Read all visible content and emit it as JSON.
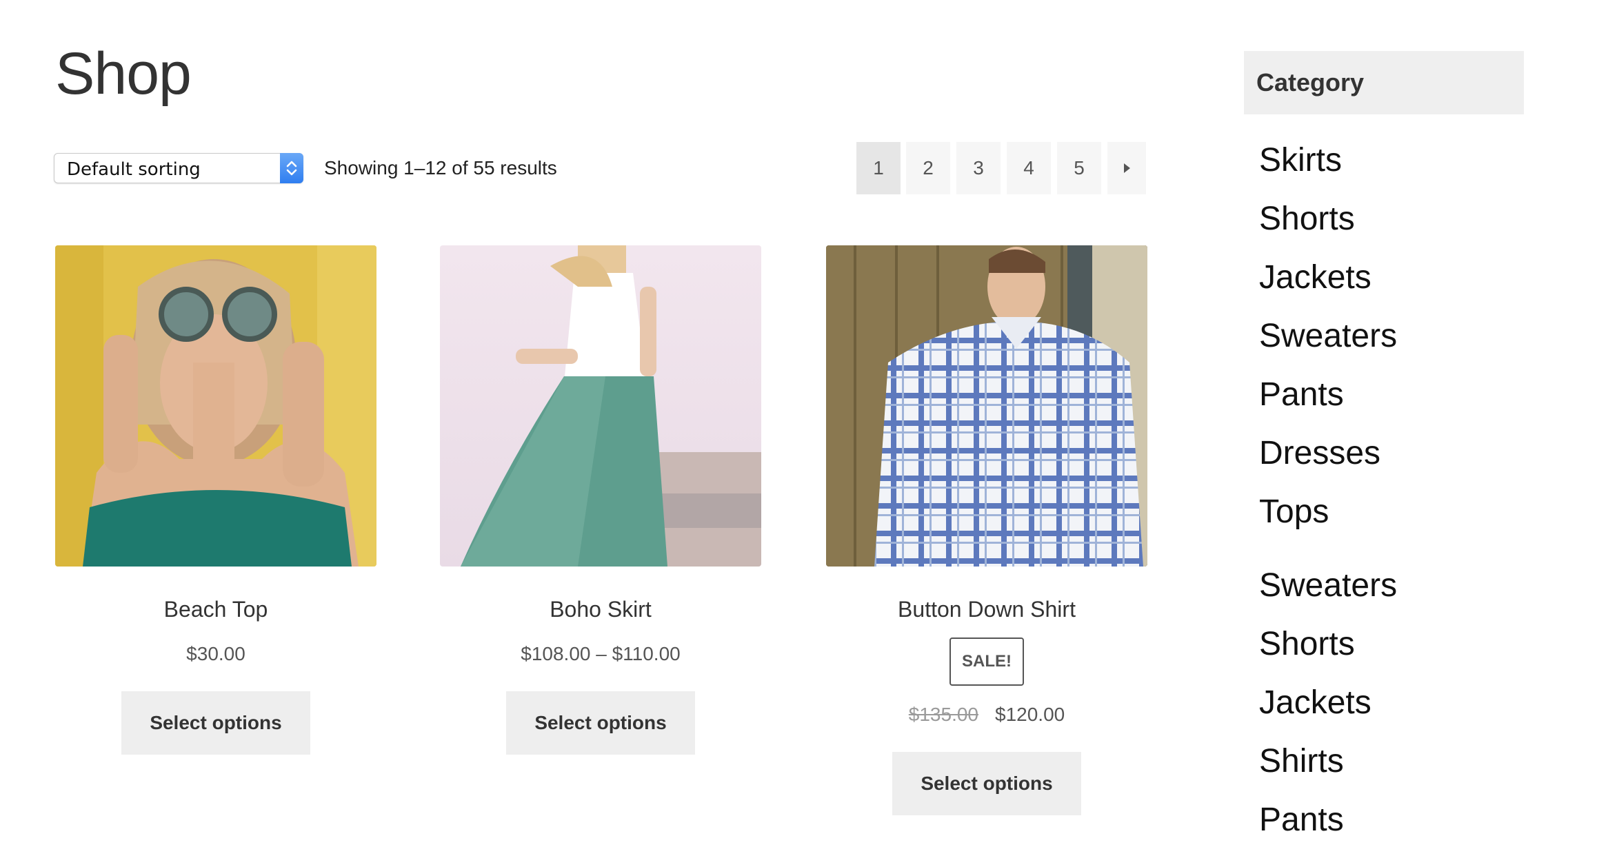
{
  "page": {
    "title": "Shop"
  },
  "toolbar": {
    "sort_value": "Default sorting",
    "result_count": "Showing 1–12 of 55 results"
  },
  "pagination": {
    "pages": [
      "1",
      "2",
      "3",
      "4",
      "5"
    ],
    "current": "1",
    "next_icon": "arrow-right-icon"
  },
  "products": [
    {
      "name": "Beach Top",
      "price": "$30.00",
      "button": "Select options"
    },
    {
      "name": "Boho Skirt",
      "price": "$108.00 – $110.00",
      "button": "Select options"
    },
    {
      "name": "Button Down Shirt",
      "badge": "SALE!",
      "old_price": "$135.00",
      "price": "$120.00",
      "button": "Select options"
    }
  ],
  "sidebar": {
    "heading": "Category",
    "categories": [
      "Skirts",
      "Shorts",
      "Jackets",
      "Sweaters",
      "Pants",
      "Dresses",
      "Tops"
    ],
    "categories_2": [
      "Sweaters",
      "Shorts",
      "Jackets",
      "Shirts",
      "Pants"
    ]
  },
  "colors": {
    "button_bg": "#eeeeee",
    "heading_bg": "#efefef",
    "select_accent": "#2f7ef0"
  }
}
